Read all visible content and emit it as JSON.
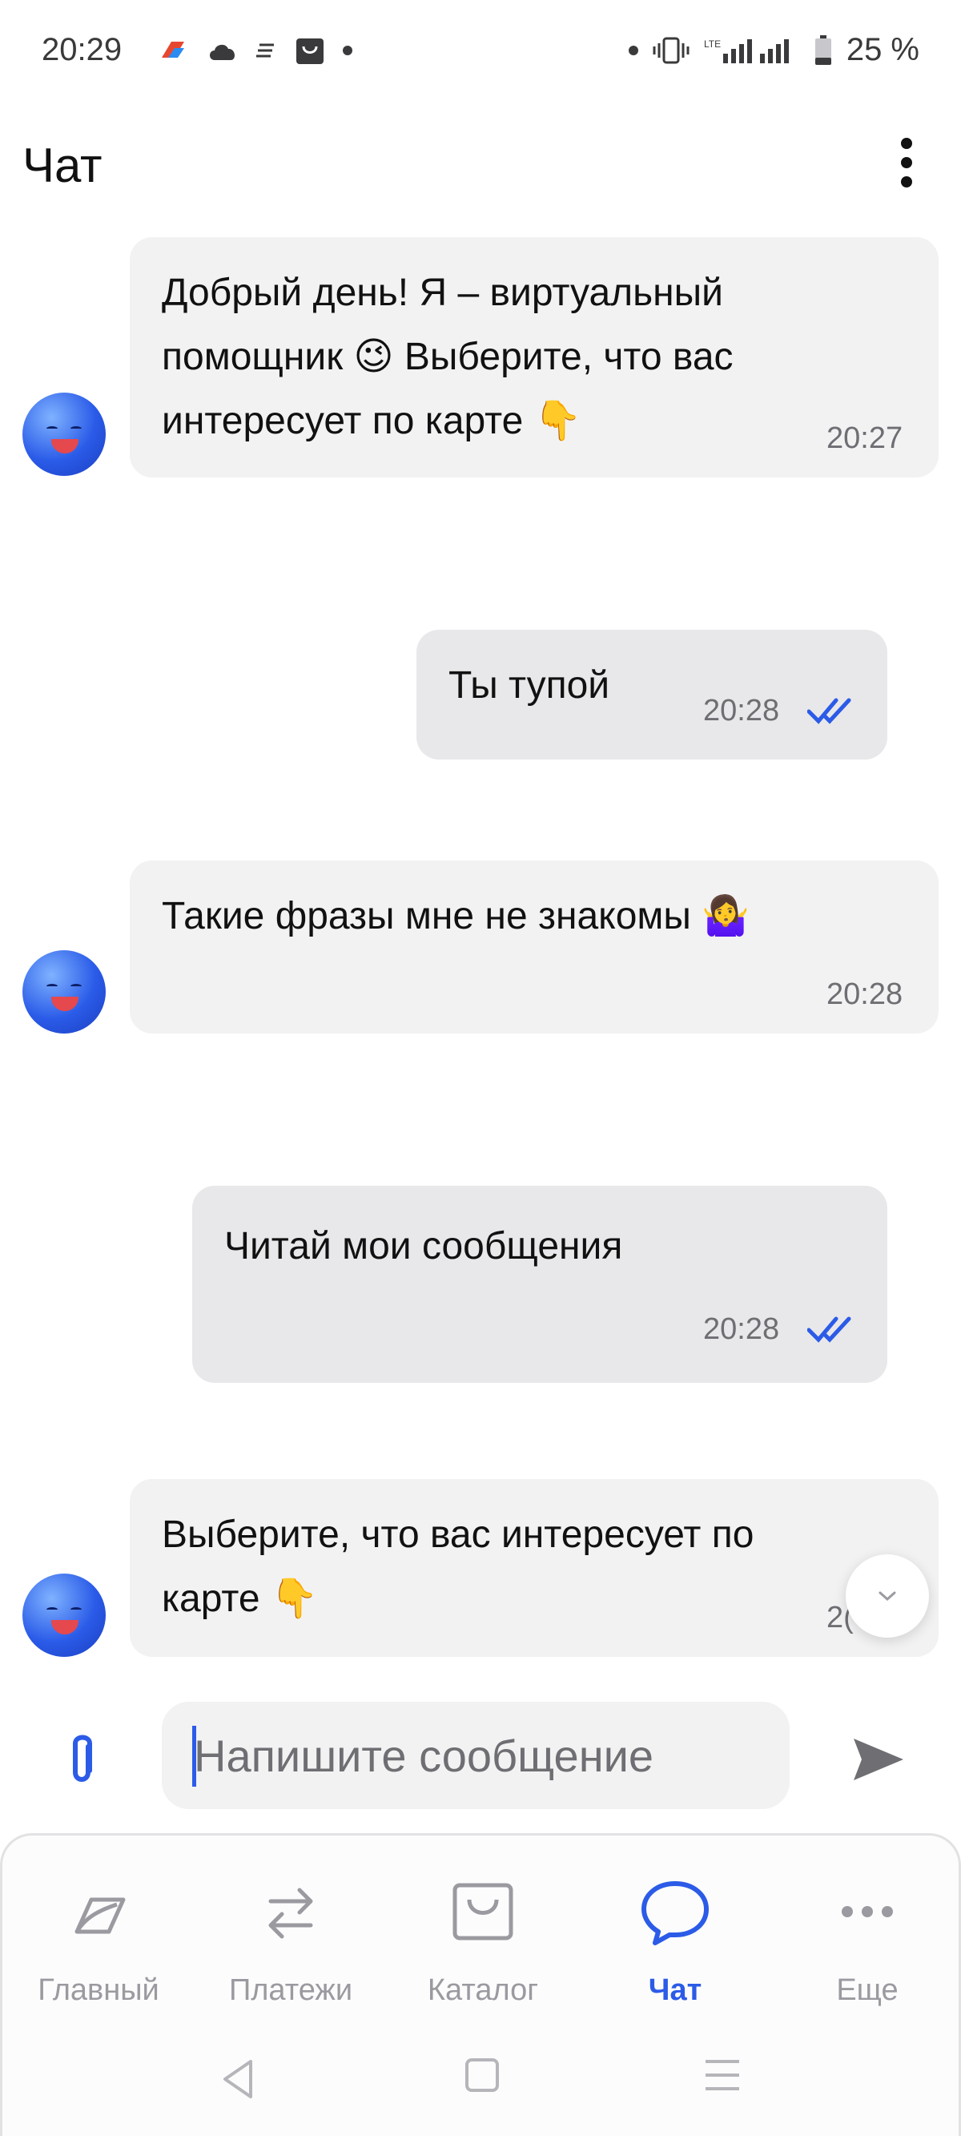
{
  "status_bar": {
    "time": "20:29",
    "battery": "25 %",
    "icons": [
      "bank-app-icon",
      "cloud-icon",
      "notes-icon",
      "shop-icon",
      "dot-icon",
      "dot-icon",
      "vibrate-icon",
      "signal-icon",
      "battery-icon"
    ]
  },
  "header": {
    "title": "Чат",
    "menu_icon": "more-vertical-icon"
  },
  "messages": [
    {
      "sender": "bot",
      "text": "Добрый день! Я – виртуальный\nпомощник 😉 Выберите, что вас\nинтересует по карте 👇",
      "time": "20:27"
    },
    {
      "sender": "user",
      "text": "Ты тупой",
      "time": "20:28",
      "read": true
    },
    {
      "sender": "bot",
      "text": "Такие фразы мне не знакомы 🤷‍♀️",
      "time": "20:28"
    },
    {
      "sender": "user",
      "text": "Читай мои сообщения",
      "time": "20:28",
      "read": true
    },
    {
      "sender": "bot",
      "text": "Выберите, что вас интересует по\nкарте 👇",
      "time": "2("
    }
  ],
  "input": {
    "placeholder": "Напишите сообщение",
    "value": ""
  },
  "nav": {
    "items": [
      {
        "label": "Главный",
        "icon": "home-icon",
        "active": false
      },
      {
        "label": "Платежи",
        "icon": "transfer-icon",
        "active": false
      },
      {
        "label": "Каталог",
        "icon": "bag-icon",
        "active": false
      },
      {
        "label": "Чат",
        "icon": "chat-icon",
        "active": true
      },
      {
        "label": "Еще",
        "icon": "more-horizontal-icon",
        "active": false
      }
    ]
  },
  "colors": {
    "accent": "#2b5be7",
    "bubble": "#f2f2f3",
    "user_bubble": "#e8e8ea",
    "inactive": "#9a9aa0"
  }
}
